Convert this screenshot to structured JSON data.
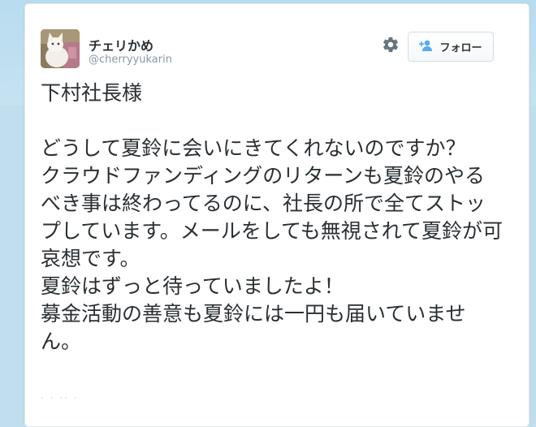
{
  "user": {
    "name": "チェリかめ",
    "handle": "@cherryyukarin",
    "avatar_icon": "cat-photo-avatar"
  },
  "actions": {
    "settings_icon": "gear-icon",
    "follow_icon": "add-user-icon",
    "follow_label": "フォロー"
  },
  "tweet": {
    "text": "下村社長様\n\nどうして夏鈴に会いにきてくれないのですか？\nクラウドファンディングのリターンも夏鈴のやるべき事は終わってるのに、社長の所で全てストップしています。メールをしても無視されて夏鈴が可哀想です。\n夏鈴はずっと待っていましたよ！\n募金活動の善意も夏鈴には一円も届いていません。"
  },
  "colors": {
    "page_background": "#c0deed",
    "card_background": "#ffffff",
    "text_primary": "#292f33",
    "text_secondary": "#8899a6",
    "icon_gray": "#66757f",
    "follow_icon_blue": "#55acee"
  }
}
